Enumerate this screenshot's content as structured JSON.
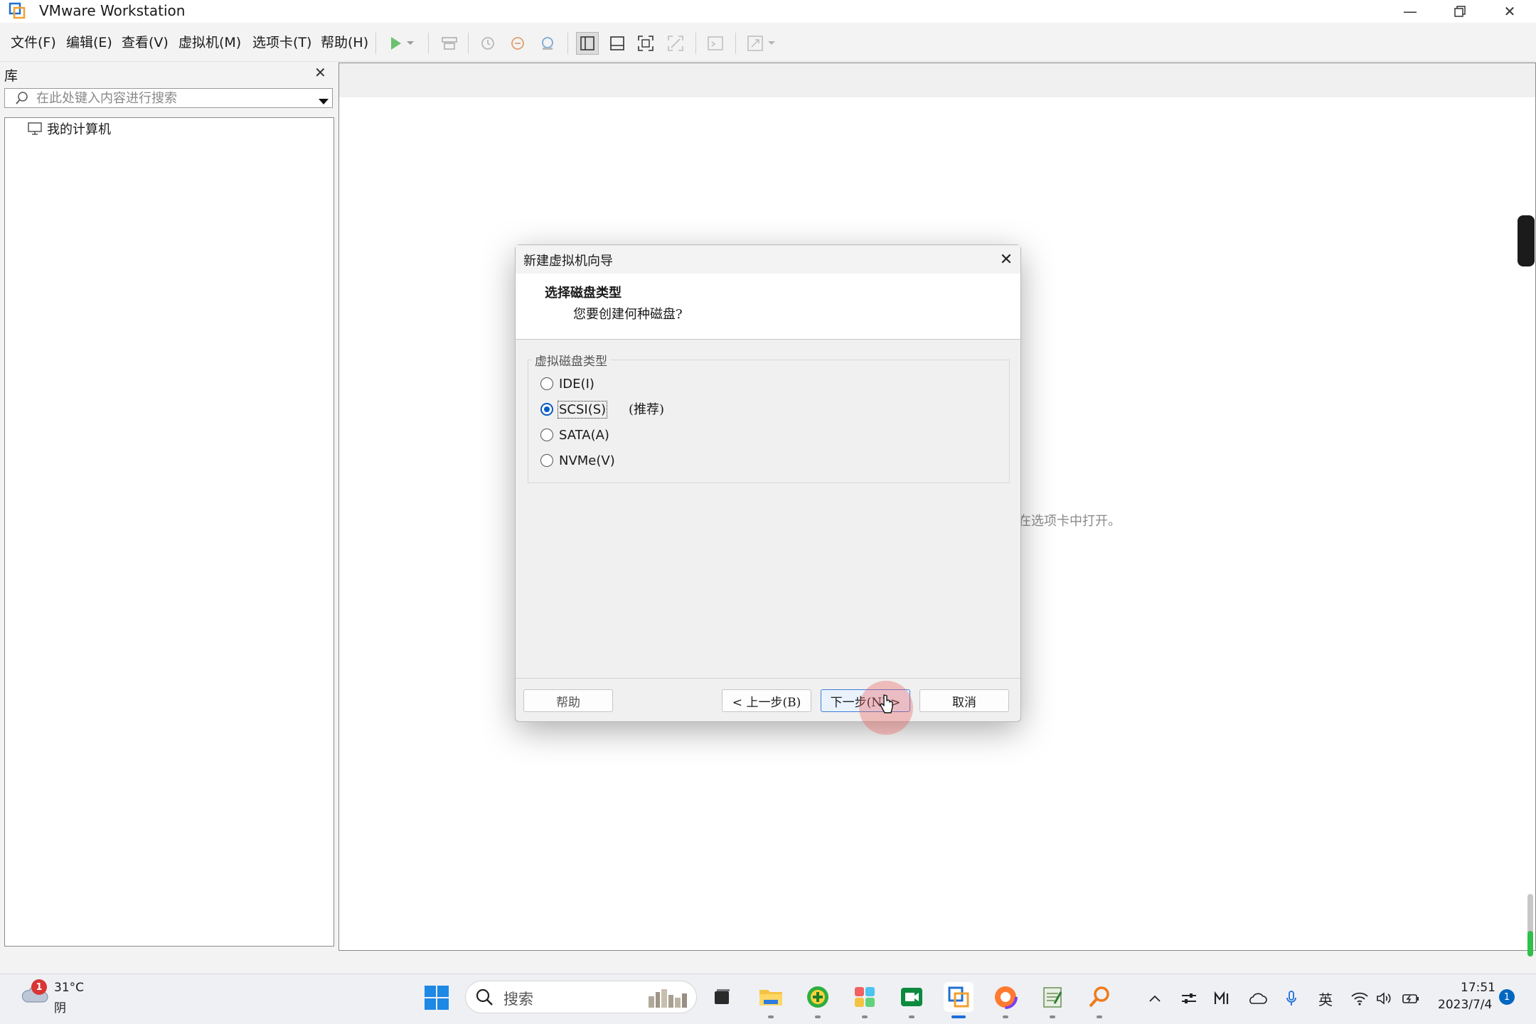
{
  "window": {
    "title": "VMware Workstation"
  },
  "menu": [
    {
      "label": "文件(F)"
    },
    {
      "label": "编辑(E)"
    },
    {
      "label": "查看(V)"
    },
    {
      "label": "虚拟机(M)"
    },
    {
      "label": "选项卡(T)"
    },
    {
      "label": "帮助(H)"
    }
  ],
  "library": {
    "title": "库",
    "search_placeholder": "在此处键入内容进行搜索",
    "tree": [
      {
        "label": "我的计算机"
      }
    ]
  },
  "main": {
    "hint_partial": "在选项卡中打开。"
  },
  "dialog": {
    "title": "新建虚拟机向导",
    "heading": "选择磁盘类型",
    "subheading": "您要创建何种磁盘?",
    "group_label": "虚拟磁盘类型",
    "options": [
      {
        "label": "IDE(I)",
        "checked": false
      },
      {
        "label": "SCSI(S)",
        "checked": true
      },
      {
        "label": "SATA(A)",
        "checked": false
      },
      {
        "label": "NVMe(V)",
        "checked": false
      }
    ],
    "recommended": "(推荐)",
    "buttons": {
      "help": "帮助",
      "back": "< 上一步(B)",
      "next": "下一步(N) >",
      "cancel": "取消"
    }
  },
  "taskbar": {
    "weather": {
      "temp": "31°C",
      "condition": "阴",
      "badge": "1"
    },
    "search_label": "搜索",
    "ime": "英",
    "clock": {
      "time": "17:51",
      "date": "2023/7/4"
    },
    "notification_count": "1"
  },
  "colors": {
    "accent": "#0a5bc4",
    "play_green": "#4caf50",
    "next_border": "#3c7fd6"
  }
}
